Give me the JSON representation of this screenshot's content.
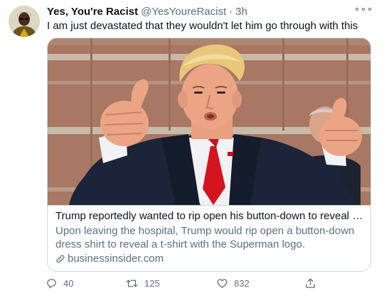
{
  "tweet": {
    "display_name": "Yes, You're Racist",
    "handle": "@YesYoureRacist",
    "separator": "·",
    "timestamp": "3h",
    "text": "I am just devastated that they wouldn't let him go through with this"
  },
  "card": {
    "title": "Trump reportedly wanted to rip open his button-down to reveal a...",
    "description": "Upon leaving the hospital, Trump would rip open a button-down dress shirt to reveal a t-shirt with the Superman logo.",
    "domain": "businessinsider.com"
  },
  "actions": {
    "replies": "40",
    "retweets": "125",
    "likes": "832"
  },
  "icons": {
    "more": "more-horizontal-icon",
    "link": "link-icon",
    "reply": "reply-icon",
    "retweet": "retweet-icon",
    "like": "heart-icon",
    "share": "share-icon"
  },
  "colors": {
    "text_primary": "#0f1419",
    "text_secondary": "#5b7083",
    "border": "#cfd9de"
  }
}
